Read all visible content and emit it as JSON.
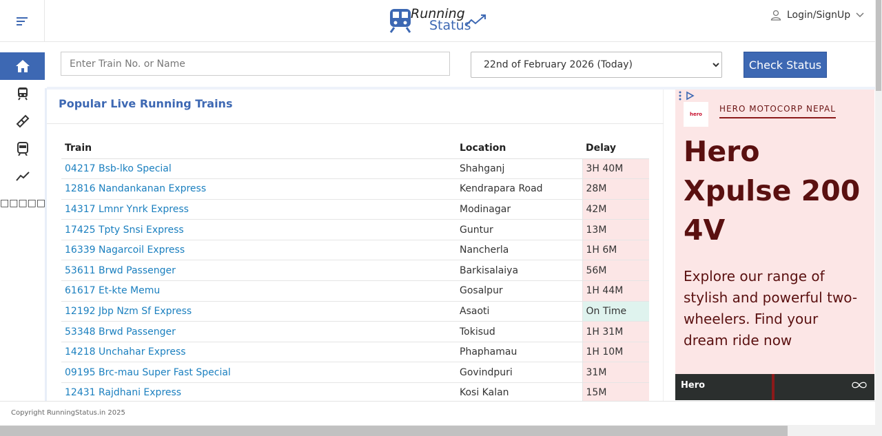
{
  "header": {
    "logo_line1": "Running",
    "logo_line2": "Status",
    "login_label": "Login/SignUp"
  },
  "sidebar": {
    "items": [
      {
        "icon": "home-icon",
        "active": true
      },
      {
        "icon": "train-icon",
        "active": false
      },
      {
        "icon": "ticket-icon",
        "active": false
      },
      {
        "icon": "metro-icon",
        "active": false
      },
      {
        "icon": "trend-icon",
        "active": false
      }
    ],
    "glyph_row": "□□□□□□"
  },
  "search": {
    "placeholder": "Enter Train No. or Name",
    "date_selected": "22nd of February 2026 (Today)",
    "button_label": "Check Status"
  },
  "popular": {
    "title": "Popular Live Running Trains",
    "columns": [
      "Train",
      "Location",
      "Delay"
    ],
    "rows": [
      {
        "train": "04217 Bsb-lko Special",
        "location": "Shahganj",
        "delay": "3H 40M",
        "status": "late"
      },
      {
        "train": "12816 Nandankanan Express",
        "location": "Kendrapara Road",
        "delay": "28M",
        "status": "late"
      },
      {
        "train": "14317 Lmnr Ynrk Express",
        "location": "Modinagar",
        "delay": "42M",
        "status": "late"
      },
      {
        "train": "17425 Tpty Snsi Express",
        "location": "Guntur",
        "delay": "13M",
        "status": "late"
      },
      {
        "train": "16339 Nagarcoil Express",
        "location": "Nancherla",
        "delay": "1H 6M",
        "status": "late"
      },
      {
        "train": "53611 Brwd Passenger",
        "location": "Barkisalaiya",
        "delay": "56M",
        "status": "late"
      },
      {
        "train": "61617 Et-kte Memu",
        "location": "Gosalpur",
        "delay": "1H 44M",
        "status": "late"
      },
      {
        "train": "12192 Jbp Nzm Sf Express",
        "location": "Asaoti",
        "delay": "On Time",
        "status": "ontime"
      },
      {
        "train": "53348 Brwd Passenger",
        "location": "Tokisud",
        "delay": "1H 31M",
        "status": "late"
      },
      {
        "train": "14218 Unchahar Express",
        "location": "Phaphamau",
        "delay": "1H 10M",
        "status": "late"
      },
      {
        "train": "09195 Brc-mau Super Fast Special",
        "location": "Govindpuri",
        "delay": "31M",
        "status": "late"
      },
      {
        "train": "12431 Rajdhani Express",
        "location": "Kosi Kalan",
        "delay": "15M",
        "status": "late"
      }
    ]
  },
  "ad": {
    "logo_text": "hero",
    "brand": "HERO MOTOCORP NEPAL",
    "headline": "Hero Xpulse 200 4V",
    "body": "Explore our range of stylish and powerful two-wheelers. Find your dream ride now",
    "image_mark": "Hero"
  },
  "footer": {
    "copyright": "Copyright RunningStatus.in 2025"
  },
  "colors": {
    "accent": "#3d68b3",
    "link": "#1a7fbf",
    "late_bg": "#fce6e6",
    "ontime_bg": "#dff3ee",
    "ad_text": "#5a1010"
  }
}
